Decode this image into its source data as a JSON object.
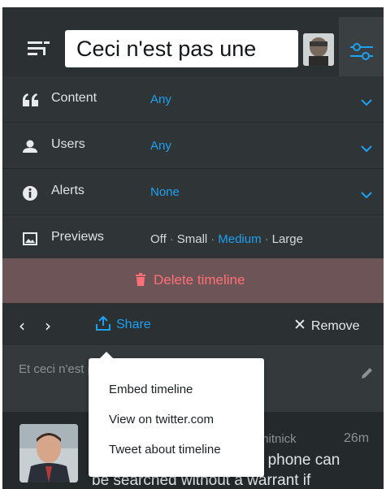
{
  "column": {
    "title_value": "Ceci n'est pas une "
  },
  "settings": {
    "content": {
      "label": "Content",
      "value": "Any"
    },
    "users": {
      "label": "Users",
      "value": "Any"
    },
    "alerts": {
      "label": "Alerts",
      "value": "None"
    },
    "previews": {
      "label": "Previews",
      "options": [
        "Off",
        "Small",
        "Medium",
        "Large"
      ],
      "selected": "Medium",
      "separator": "·"
    }
  },
  "delete": {
    "label": "Delete timeline"
  },
  "actions": {
    "prev": "‹",
    "next": "›",
    "share": "Share",
    "remove": "Remove"
  },
  "description": {
    "text": "Et ceci n'est pas une description en moins de"
  },
  "tweet": {
    "username": "mitnick",
    "time": "26m",
    "text_line1": "r phone can",
    "text_line2": "be searched  without a warrant if"
  },
  "share_menu": {
    "items": [
      "Embed timeline",
      "View on twitter.com",
      "Tweet about timeline"
    ]
  },
  "colors": {
    "accent": "#1da1f2",
    "danger": "#ff6f75",
    "background": "#1e2325"
  }
}
